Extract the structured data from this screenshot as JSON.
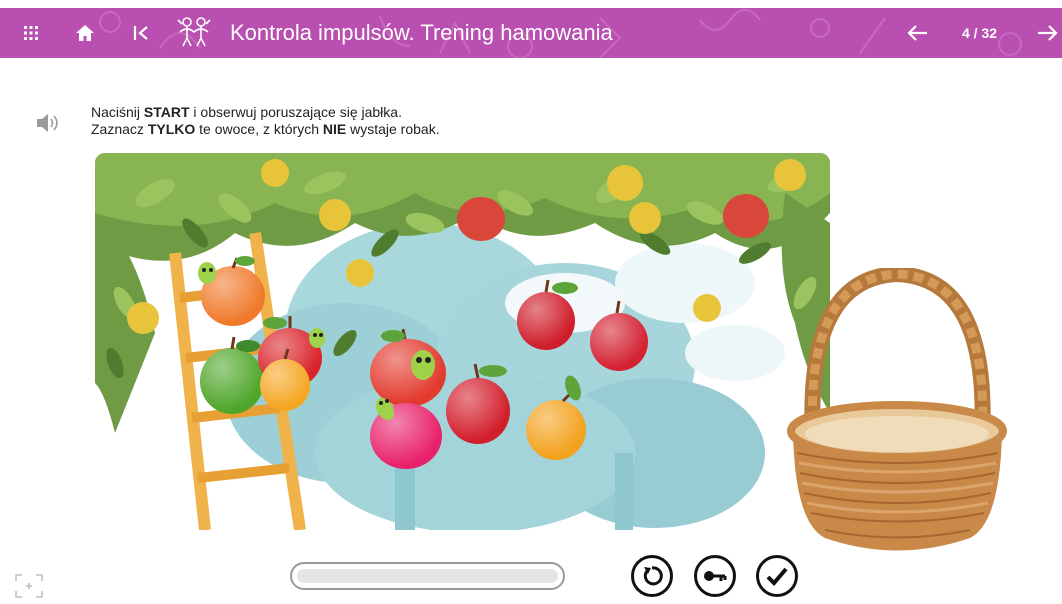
{
  "header": {
    "title": "Kontrola impulsów. Trening hamowania",
    "page_counter": "4 / 32",
    "background_color": "#b94fb0",
    "icons": [
      "grid-menu-icon",
      "home-icon",
      "first-page-icon",
      "exercise-category-icon",
      "arrow-left-icon",
      "arrow-right-icon"
    ]
  },
  "instructions": {
    "line1": {
      "p1": "Naciśnij ",
      "b1": "START",
      "p2": " i obserwuj poruszające się jabłka."
    },
    "line2": {
      "p1": "Zaznacz ",
      "b1": "TYLKO",
      "p2": " te owoce, z których ",
      "b2": "NIE",
      "p3": " wystaje robak."
    }
  },
  "scene": {
    "apples": [
      {
        "name": "apple-orange-worm",
        "color": "#f07a2c",
        "has_worm": true
      },
      {
        "name": "apple-green",
        "color": "#4fa62a",
        "has_worm": false
      },
      {
        "name": "apple-red-worm-left",
        "color": "#d9242a",
        "has_worm": true
      },
      {
        "name": "apple-yellow-left",
        "color": "#f5a623",
        "has_worm": false
      },
      {
        "name": "apple-red-worm-center",
        "color": "#e33a2e",
        "has_worm": true
      },
      {
        "name": "apple-pink-worm",
        "color": "#e8226a",
        "has_worm": true
      },
      {
        "name": "apple-red-center",
        "color": "#d31f2c",
        "has_worm": false
      },
      {
        "name": "apple-yellow-right",
        "color": "#f3a21e",
        "has_worm": false
      },
      {
        "name": "apple-red-top-right",
        "color": "#cf1d2a",
        "has_worm": false
      },
      {
        "name": "apple-red-right",
        "color": "#d42232",
        "has_worm": false
      }
    ]
  },
  "controls": {
    "progress": 0,
    "buttons": [
      "restart-icon",
      "key-icon",
      "check-icon"
    ]
  }
}
